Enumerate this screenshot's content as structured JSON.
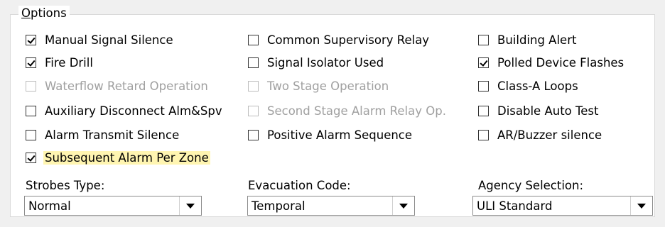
{
  "group": {
    "title_accel": "O",
    "title_rest": "ptions"
  },
  "options": {
    "manual_signal_silence": {
      "label": "Manual Signal Silence",
      "checked": true
    },
    "fire_drill": {
      "label": "Fire Drill",
      "checked": true
    },
    "waterflow_retard_operation": {
      "label": "Waterflow Retard Operation",
      "checked": false,
      "disabled": true
    },
    "auxiliary_disconnect": {
      "label": "Auxiliary Disconnect Alm&Spv",
      "checked": false
    },
    "alarm_transmit_silence": {
      "label": "Alarm Transmit Silence",
      "checked": false
    },
    "subsequent_alarm_per_zone": {
      "label": "Subsequent Alarm Per Zone",
      "checked": true
    },
    "common_supervisory_relay": {
      "label": "Common Supervisory Relay",
      "checked": false
    },
    "signal_isolator_used": {
      "label": "Signal Isolator Used",
      "checked": false
    },
    "two_stage_operation": {
      "label": "Two Stage Operation",
      "checked": false,
      "disabled": true
    },
    "second_stage_alarm_relay": {
      "label": "Second Stage Alarm Relay Op.",
      "checked": false,
      "disabled": true
    },
    "positive_alarm_sequence": {
      "label": "Positive Alarm Sequence",
      "checked": false
    },
    "building_alert": {
      "label": "Building Alert",
      "checked": false
    },
    "polled_device_flashes": {
      "label": "Polled Device Flashes",
      "checked": true
    },
    "class_a_loops": {
      "label": "Class-A Loops",
      "checked": false
    },
    "disable_auto_test": {
      "label": "Disable Auto Test",
      "checked": false
    },
    "ar_buzzer_silence": {
      "label": "AR/Buzzer silence",
      "checked": false
    }
  },
  "selects": {
    "strobes_type": {
      "label": "Strobes Type:",
      "value": "Normal"
    },
    "evacuation_code": {
      "label": "Evacuation Code:",
      "value": "Temporal"
    },
    "agency_selection": {
      "label": "Agency Selection:",
      "value": "ULI Standard"
    }
  },
  "colors": {
    "highlight": "#fff5b1",
    "disabled_text": "#a0a0a0"
  }
}
